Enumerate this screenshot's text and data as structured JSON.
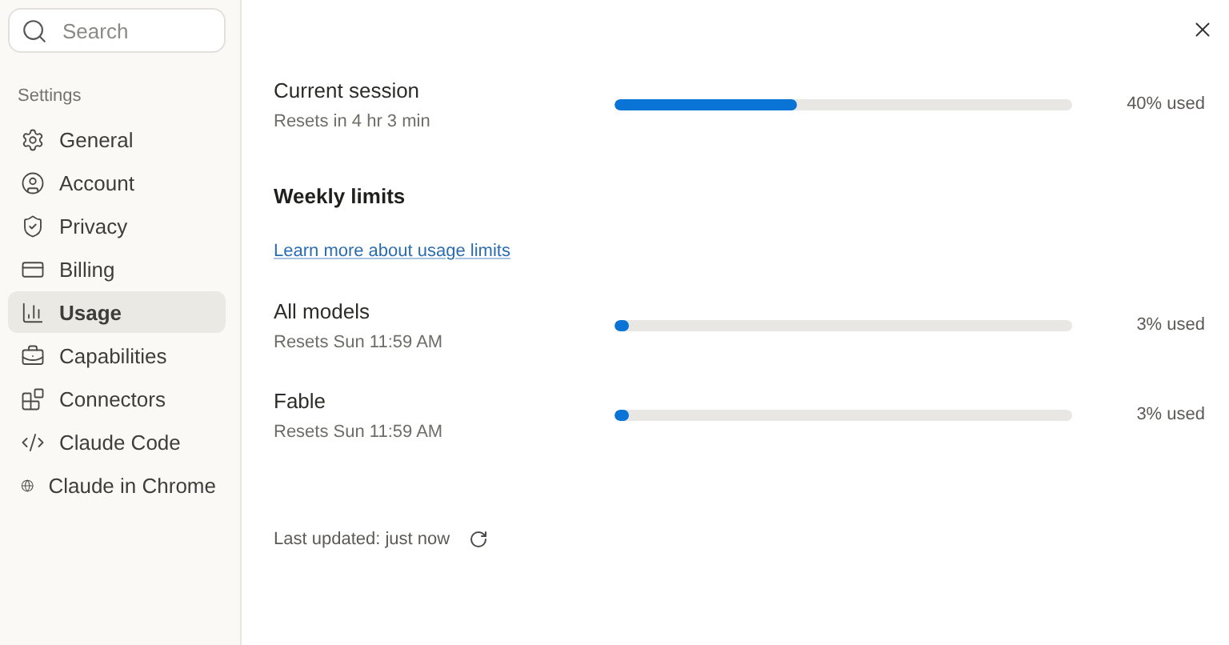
{
  "sidebar": {
    "search": {
      "placeholder": "Search"
    },
    "section_label": "Settings",
    "items": [
      {
        "label": "General",
        "selected": false
      },
      {
        "label": "Account",
        "selected": false
      },
      {
        "label": "Privacy",
        "selected": false
      },
      {
        "label": "Billing",
        "selected": false
      },
      {
        "label": "Usage",
        "selected": true
      },
      {
        "label": "Capabilities",
        "selected": false
      },
      {
        "label": "Connectors",
        "selected": false
      },
      {
        "label": "Claude Code",
        "selected": false
      },
      {
        "label": "Claude in Chrome",
        "selected": false
      }
    ]
  },
  "session": {
    "title": "Current session",
    "subtitle": "Resets in 4 hr 3 min",
    "level": 0.4,
    "reading": "40% used"
  },
  "weekly": {
    "heading": "Weekly limits",
    "link": "Learn more about usage limits",
    "limits": [
      {
        "title": "All models",
        "subtitle": "Resets Sun 11:59 AM",
        "level": 0.03,
        "reading": "3% used"
      },
      {
        "title": "Fable",
        "subtitle": "Resets Sun 11:59 AM",
        "level": 0.03,
        "reading": "3% used"
      }
    ]
  },
  "footer": {
    "text": "Last updated: just now"
  }
}
